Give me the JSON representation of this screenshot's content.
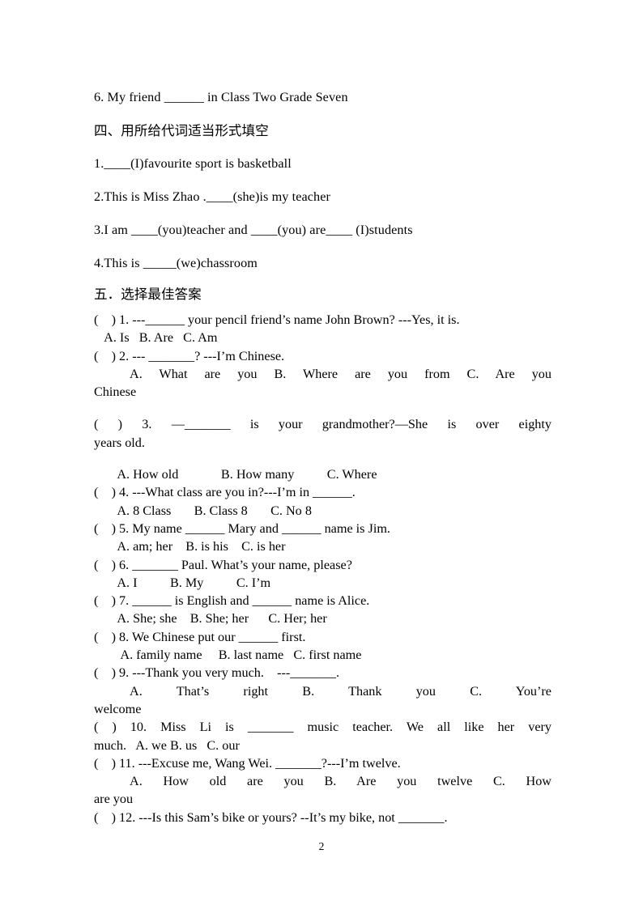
{
  "document": {
    "page_number": "2",
    "part4": {
      "carryover_line": "6. My friend ______ in Class Two Grade Seven",
      "heading": "四、用所给代词适当形式填空",
      "items": [
        "1.____(I)favourite sport is basketball",
        "2.This is Miss Zhao .____(she)is my teacher",
        "3.I am ____(you)teacher and ____(you) are____ (I)students",
        "4.This is _____(we)chassroom"
      ]
    },
    "part5": {
      "heading": "五．选择最佳答案",
      "questions": [
        {
          "stem": "(    ) 1. ---______ your pencil friend’s name John Brown? ---Yes, it is.",
          "options": "   A. Is   B. Are   C. Am"
        },
        {
          "stem": "(    ) 2. --- _______? ---I’m Chinese.",
          "options": "A. What are you    B. Where are you from    C. Are you",
          "options_wrap": "Chinese"
        },
        {
          "stem": "(    ) 3. —_______ is your grandmother?—She is over eighty",
          "stem_wrap": "years old.",
          "options": "       A. How old             B. How many          C. Where"
        },
        {
          "stem": "(    ) 4. ---What class are you in?---I’m in ______.",
          "options": "       A. 8 Class       B. Class 8       C. No 8"
        },
        {
          "stem": "(    ) 5. My name ______ Mary and ______ name is Jim.",
          "options": "       A. am; her    B. is his    C. is her"
        },
        {
          "stem": "(    ) 6. _______ Paul. What’s your name, please?",
          "options": "       A. I          B. My          C. I’m"
        },
        {
          "stem": "(    ) 7. ______ is English and ______ name is Alice.",
          "options": "       A. She; she    B. She; her      C. Her; her"
        },
        {
          "stem": "(    ) 8. We Chinese put our ______ first.",
          "options": "        A. family name     B. last name   C. first name"
        },
        {
          "stem": "(    ) 9. ---Thank you very much.    ---_______.",
          "options": "A. That’s right          B. Thank you          C. You’re",
          "options_wrap": "welcome"
        },
        {
          "stem": "(    ) 10. Miss Li is _______ music teacher. We all like her very",
          "stem_wrap": "much.   A. we B. us   C. our"
        },
        {
          "stem": "(    ) 11. ---Excuse me, Wang Wei. _______?---I’m twelve.",
          "options": "A. How old are you      B. Are you twelve      C. How",
          "options_wrap": "are you"
        },
        {
          "stem": "(    ) 12. ---Is this Sam’s bike or yours? --It’s my bike, not _______."
        }
      ]
    }
  }
}
